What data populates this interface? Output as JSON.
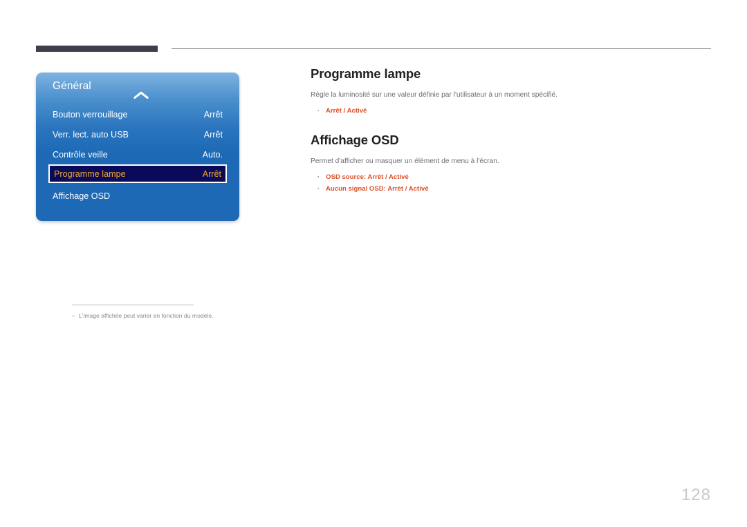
{
  "page": {
    "number": "128"
  },
  "osd_menu": {
    "title": "Général",
    "collapse_icon": "chevron-up-icon",
    "rows": [
      {
        "label": "Bouton verrouillage",
        "value": "Arrêt",
        "selected": false
      },
      {
        "label": "Verr. lect. auto USB",
        "value": "Arrêt",
        "selected": false
      },
      {
        "label": "Contrôle veille",
        "value": "Auto.",
        "selected": false
      },
      {
        "label": "Programme lampe",
        "value": "Arrêt",
        "selected": true
      },
      {
        "label": "Affichage OSD",
        "value": "",
        "selected": false
      }
    ],
    "colors": {
      "panel_top": "#7fb3e0",
      "panel_bottom": "#1d69b5",
      "selected_bg": "#0a0a58",
      "selected_text": "#f0a830",
      "selected_border": "#ffffff"
    }
  },
  "footnote": {
    "dash": "‒",
    "text": "L'image affichée peut varier en fonction du modèle."
  },
  "sections": [
    {
      "title": "Programme lampe",
      "body": "Règle la luminosité sur une valeur définie par l'utilisateur à un moment spécifié.",
      "bullets": [
        {
          "dot": "·",
          "text": "Arrêt / Activé"
        }
      ]
    },
    {
      "title": "Affichage OSD",
      "body": "Permet d'afficher ou masquer un élément de menu à l'écran.",
      "bullets": [
        {
          "dot": "·",
          "text": "OSD source: Arrêt / Activé"
        },
        {
          "dot": "·",
          "text": "Aucun signal OSD: Arrêt / Activé"
        }
      ]
    }
  ],
  "theme": {
    "header_bar": "#413e4c",
    "header_line": "#8e8d94",
    "accent_orange": "#dd5129",
    "body_gray": "#6c6c72",
    "page_num_gray": "#c9c8d2"
  }
}
